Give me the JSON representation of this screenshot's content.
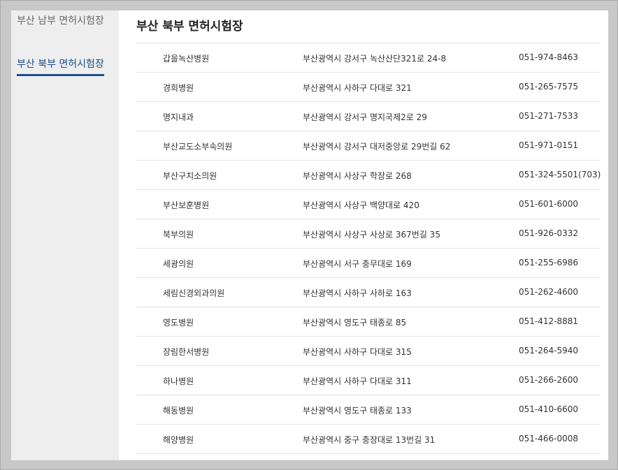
{
  "sidebar": {
    "items": [
      {
        "label": "부산 남부 면허시험장"
      },
      {
        "label": "부산 북부 면허시험장"
      }
    ]
  },
  "main": {
    "title": "부산 북부 면허시험장",
    "rows": [
      {
        "name": "갑을녹산병원",
        "address": "부산광역시 강서구 녹산산단321로 24-8",
        "phone": "051-974-8463"
      },
      {
        "name": "경희병원",
        "address": "부산광역시 사하구 다대로 321",
        "phone": "051-265-7575"
      },
      {
        "name": "명지내과",
        "address": "부산광역시 강서구 명지국제2로 29",
        "phone": "051-271-7533"
      },
      {
        "name": "부산교도소부속의원",
        "address": "부산광역시 강서구 대저중앙로 29번길 62",
        "phone": "051-971-0151"
      },
      {
        "name": "부산구치소의원",
        "address": "부산광역시 사상구 학장로 268",
        "phone": "051-324-5501(703)"
      },
      {
        "name": "부산보훈병원",
        "address": "부산광역시 사상구 백양대로 420",
        "phone": "051-601-6000"
      },
      {
        "name": "북부의원",
        "address": "부산광역시 사상구 사상로 367번길 35",
        "phone": "051-926-0332"
      },
      {
        "name": "세광의원",
        "address": "부산광역시 서구 충무대로 169",
        "phone": "051-255-6986"
      },
      {
        "name": "세림신경외과의원",
        "address": "부산광역시 사하구 사하로 163",
        "phone": "051-262-4600"
      },
      {
        "name": "영도병원",
        "address": "부산광역시 영도구 태종로 85",
        "phone": "051-412-8881"
      },
      {
        "name": "장림한서병원",
        "address": "부산광역시 사하구 다대로 315",
        "phone": "051-264-5940"
      },
      {
        "name": "하나병원",
        "address": "부산광역시 사하구 다대로 311",
        "phone": "051-266-2600"
      },
      {
        "name": "해동병원",
        "address": "부산광역시 영도구 태종로 133",
        "phone": "051-410-6600"
      },
      {
        "name": "해양병원",
        "address": "부산광역시 중구 충장대로 13번길 31",
        "phone": "051-466-0008"
      }
    ]
  }
}
